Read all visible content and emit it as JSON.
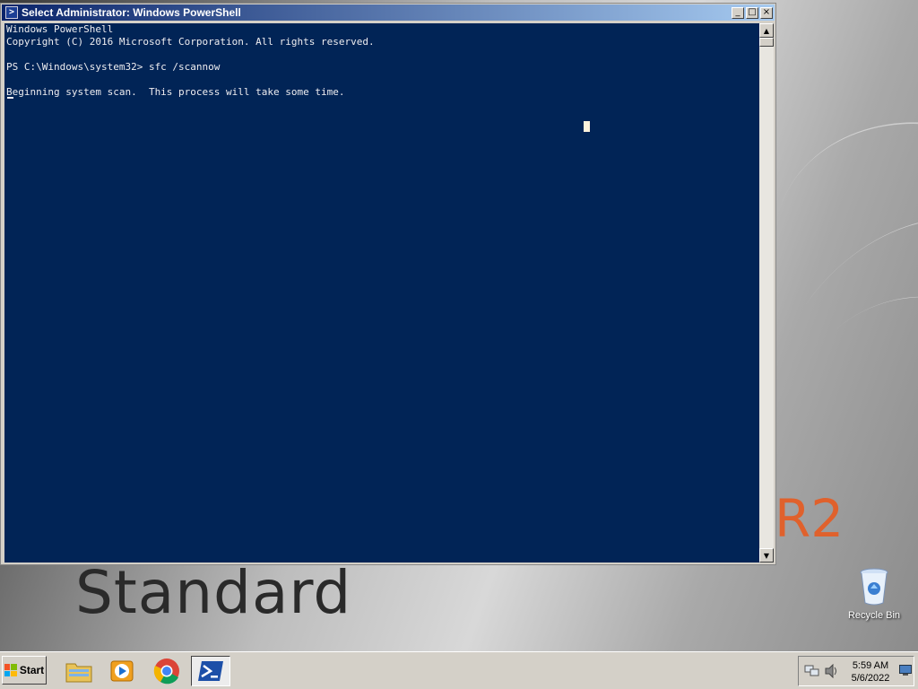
{
  "window": {
    "title": "Select Administrator: Windows PowerShell",
    "buttons": {
      "minimize": "_",
      "maximize": "□",
      "close": "×"
    }
  },
  "console": {
    "lines": [
      "Windows PowerShell",
      "Copyright (C) 2016 Microsoft Corporation. All rights reserved.",
      "",
      "PS C:\\Windows\\system32> sfc /scannow",
      "",
      "Beginning system scan.  This process will take some time.",
      ""
    ],
    "colors": {
      "background": "#012456",
      "text": "#eeedf0"
    }
  },
  "desktop": {
    "branding": {
      "edition": "Standard",
      "release": "R2"
    },
    "icons": [
      {
        "label": "Recycle Bin",
        "icon": "recycle-bin-icon"
      }
    ]
  },
  "taskbar": {
    "start_label": "Start",
    "pinned": [
      {
        "name": "file-explorer",
        "icon": "folder-icon"
      },
      {
        "name": "media-player",
        "icon": "media-player-icon"
      },
      {
        "name": "chrome",
        "icon": "chrome-icon"
      },
      {
        "name": "powershell",
        "icon": "powershell-icon",
        "active": true
      }
    ],
    "tray": {
      "time": "5:59 AM",
      "date": "5/6/2022"
    }
  }
}
